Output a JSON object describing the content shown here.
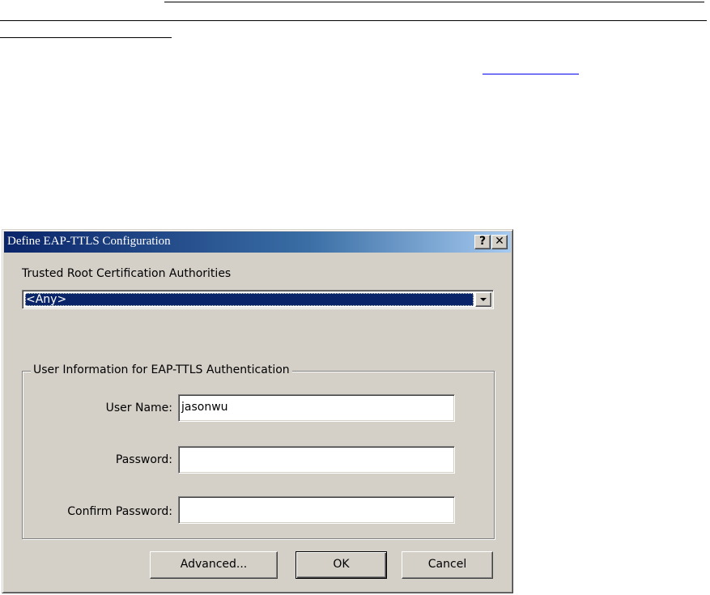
{
  "dialog": {
    "title": "Define EAP-TTLS Configuration",
    "help_button": "?",
    "close_button": "✕",
    "trusted_root_label": "Trusted Root Certification Authorities",
    "trusted_root_value": "<Any>",
    "group_title": "User Information for EAP-TTLS Authentication",
    "fields": {
      "user_name_label": "User Name:",
      "user_name_value": "jasonwu",
      "password_label": "Password:",
      "password_value": "",
      "confirm_password_label": "Confirm Password:",
      "confirm_password_value": ""
    },
    "buttons": {
      "advanced": "Advanced...",
      "ok": "OK",
      "cancel": "Cancel"
    }
  },
  "colors": {
    "dialog_face": "#d4d0c8",
    "titlebar_start": "#0a246a",
    "titlebar_end": "#a6caf0",
    "selection": "#0a246a",
    "link": "#0000ee"
  }
}
